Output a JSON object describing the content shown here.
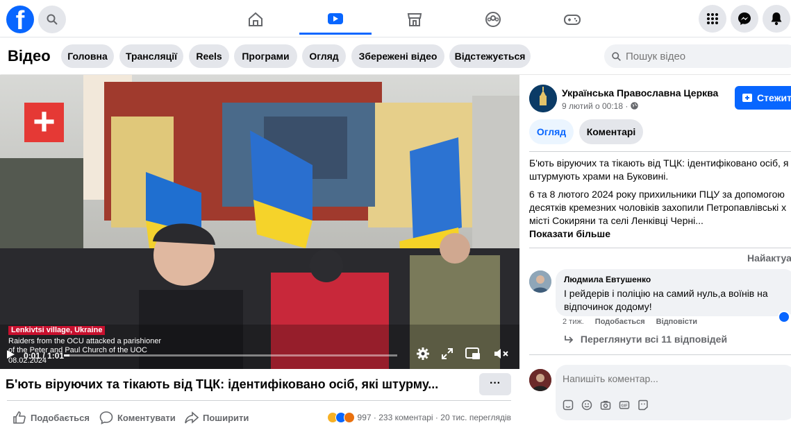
{
  "nav": {
    "logo": "f",
    "search_icon": "search-icon",
    "tabs": [
      "home-icon",
      "video-icon",
      "marketplace-icon",
      "groups-icon",
      "gaming-icon"
    ],
    "active_tab": "video-icon",
    "right_buttons": [
      "menu-grid-icon",
      "messenger-icon",
      "notifications-icon"
    ],
    "brand_color": "#0866ff"
  },
  "subnav": {
    "title": "Відео",
    "pills": [
      "Головна",
      "Трансляції",
      "Reels",
      "Програми",
      "Огляд",
      "Збережені відео",
      "Відстежується"
    ],
    "search_placeholder": "Пошук відео"
  },
  "video": {
    "logo_glyph": "+",
    "location": "Lenkivtsi village, Ukraine",
    "caption_line1": "Raiders from the OCU attacked a parishioner",
    "caption_line2": "of the Peter and Paul Church of the UOC",
    "caption_date": "08.02.2024",
    "time": "0:01 / 1:01",
    "progress": 0.016
  },
  "post": {
    "title": "Б'ють віруючих та тікають від ТЦК: ідентифіковано осіб, які штурму...",
    "more_label": "···",
    "like_label": "Подобається",
    "comment_label": "Коментувати",
    "share_label": "Поширити",
    "reactions_count": "997",
    "comments_count": "233 коментарі",
    "views": "20 тис. переглядів"
  },
  "sidebar": {
    "page_name": "Українська Православна Церква",
    "date": "9 лютий о 00:18 ·",
    "follow_label": "Стежити",
    "tab_overview": "Огляд",
    "tab_comments": "Коментарі",
    "desc_line1": "Б'ють віруючих та тікають від ТЦК: ідентифіковано осіб, я",
    "desc_line2": "штурмують храми на Буковині.",
    "desc_line3": "6 та 8 лютого 2024 року прихильники ПЦУ за допомогою",
    "desc_line4": "десятків кремезних чоловіків захопили Петропавлівські х",
    "desc_line5": "місті Сокиряни та селі Ленківці Черні...",
    "show_more": "Показати більше",
    "sort_label": "Найактуа",
    "comment": {
      "author": "Людмила Евтушенко",
      "line1": "І рейдерів і поліцію на самий нуль,а воїнів на",
      "line2": "відпочинок додому!",
      "time": "2 тиж.",
      "like": "Подобається",
      "reply": "Відповісти"
    },
    "view_replies": "Переглянути всі 11 відповідей",
    "composer_placeholder": "Напишіть коментар..."
  }
}
